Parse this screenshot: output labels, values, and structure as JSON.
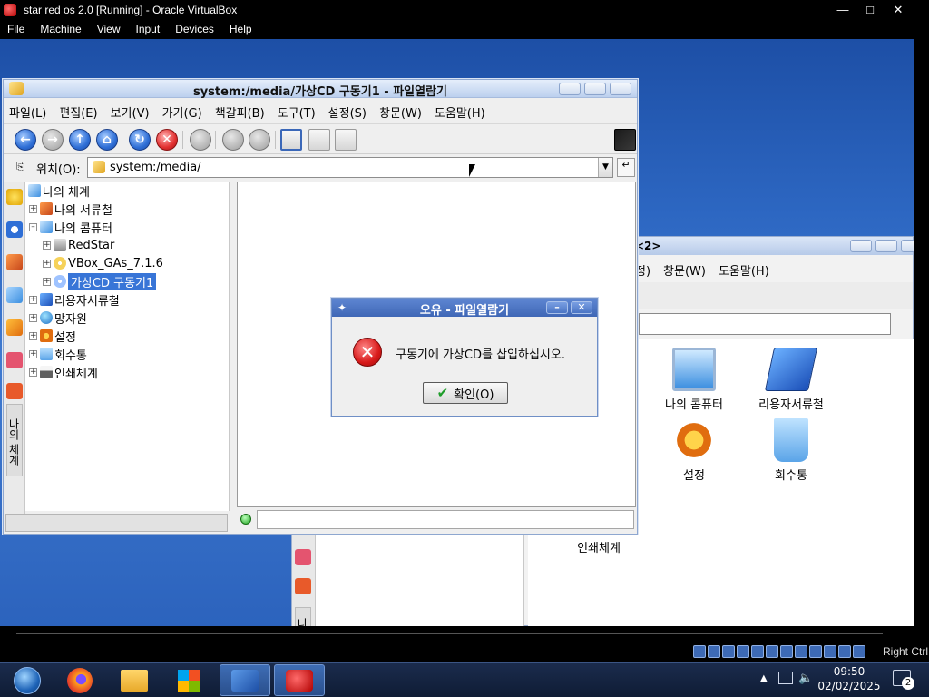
{
  "host": {
    "title": "star red os 2.0 [Running] - Oracle VirtualBox",
    "menu": [
      "File",
      "Machine",
      "View",
      "Input",
      "Devices",
      "Help"
    ],
    "status_key": "Right Ctrl"
  },
  "taskbar": {
    "time": "09:50",
    "date": "02/02/2025",
    "notification_count": "2"
  },
  "file_manager": {
    "title": "system:/media/가상CD 구동기1 - 파일열람기",
    "menu": [
      "파일(L)",
      "편집(E)",
      "보기(V)",
      "가기(G)",
      "책갈피(B)",
      "도구(T)",
      "설정(S)",
      "창문(W)",
      "도움말(H)"
    ],
    "location_label": "위치(O):",
    "location_value": "system:/media/",
    "side_tab": "나의 체계",
    "tree": [
      {
        "label": "나의 체계",
        "expanded": true
      },
      {
        "label": "나의 서류철"
      },
      {
        "label": "나의 콤퓨터",
        "expanded": true
      },
      {
        "label": "RedStar"
      },
      {
        "label": "VBox_GAs_7.1.6"
      },
      {
        "label": "가상CD 구동기1",
        "selected": true
      },
      {
        "label": "리용자서류철"
      },
      {
        "label": "망자원"
      },
      {
        "label": "설정"
      },
      {
        "label": "회수통"
      },
      {
        "label": "인쇄체계"
      }
    ]
  },
  "background_window": {
    "title": "<2>",
    "menu": [
      "정)",
      "창문(W)",
      "도움말(H)"
    ],
    "side_tab": "나의 체계",
    "icons": [
      "나의 콤퓨터",
      "리용자서류철",
      "설정",
      "회수통",
      "인쇄체계"
    ]
  },
  "error_dialog": {
    "title": "오유 - 파일열람기",
    "message": "구동기에 가상CD를 삽입하십시오.",
    "ok_label": "확인(O)"
  },
  "colors": {
    "selection": "#3875d7",
    "dialog_title": "#4a72c0",
    "error_red": "#d81a1a",
    "desktop": "#2d67c2"
  }
}
